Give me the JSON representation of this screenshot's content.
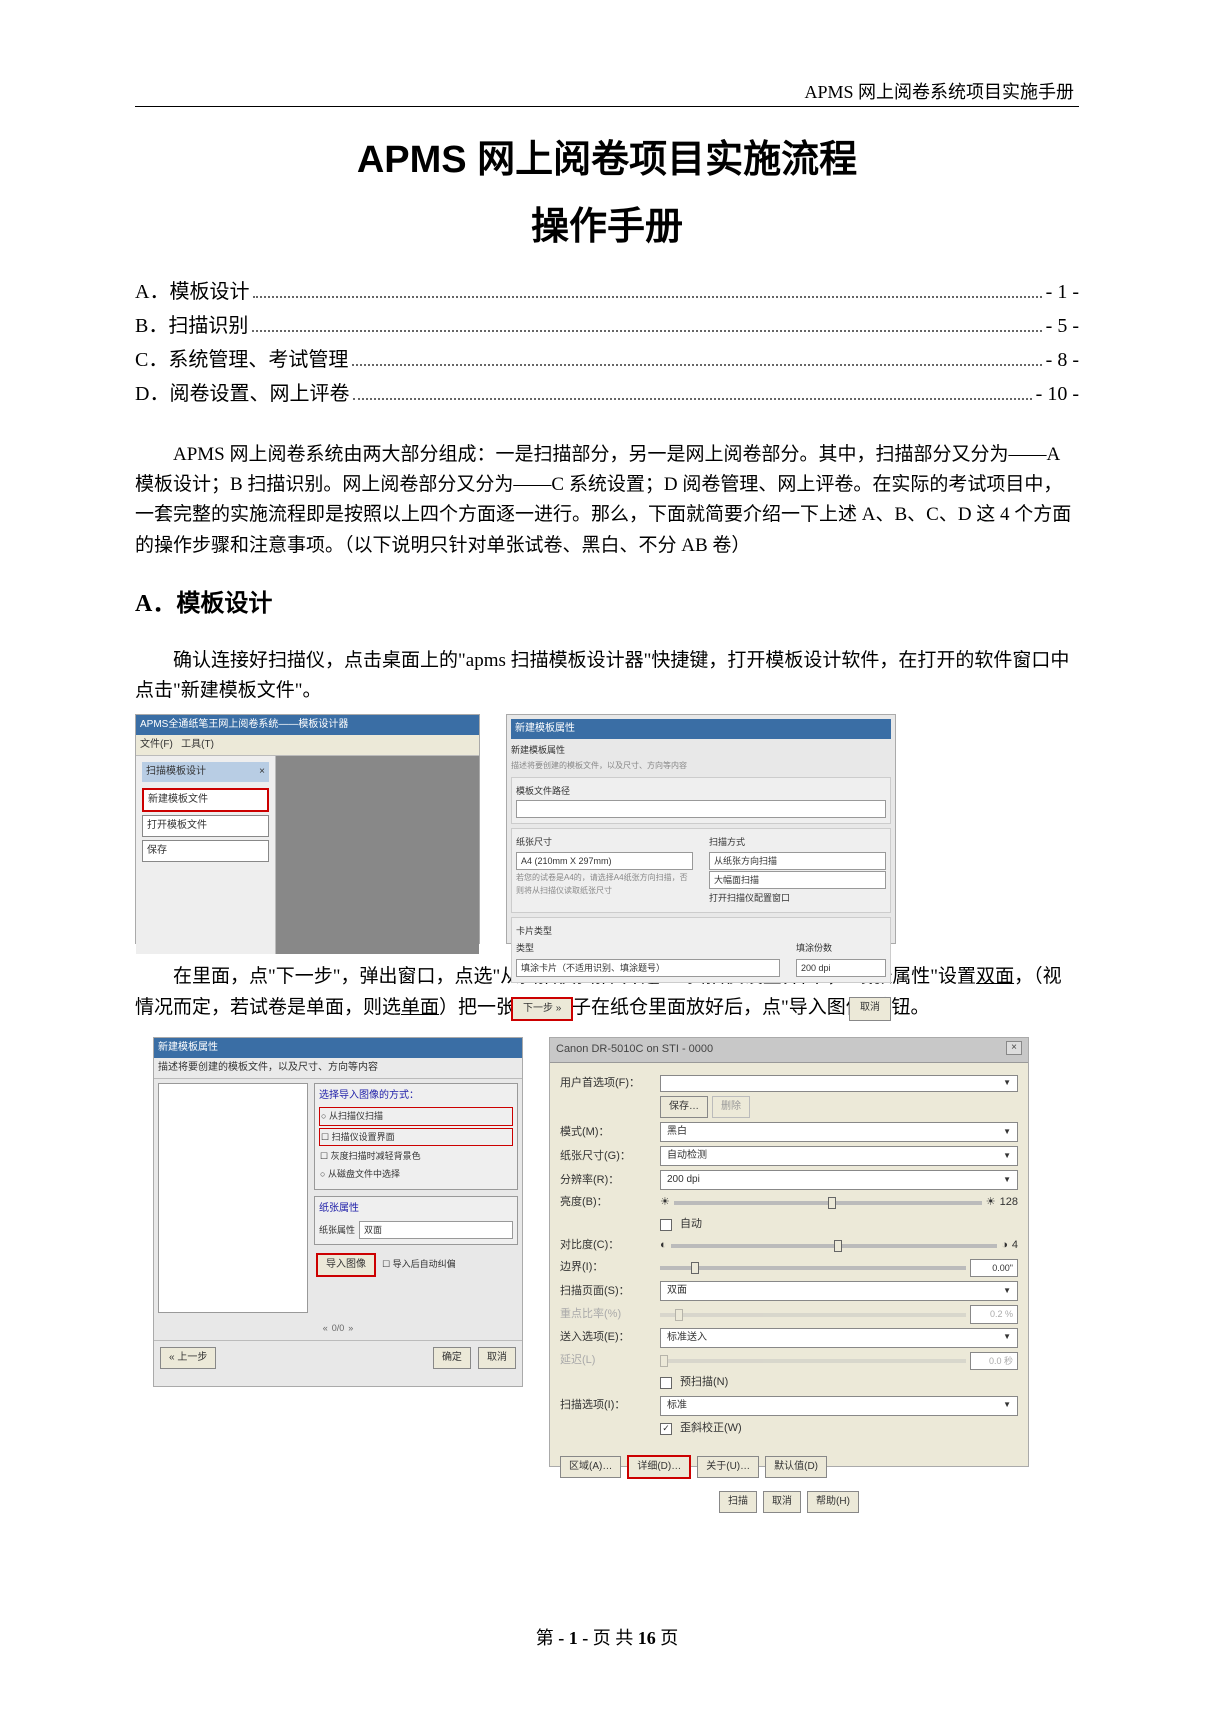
{
  "header": "APMS 网上阅卷系统项目实施手册",
  "title": "APMS 网上阅卷项目实施流程",
  "subtitle": "操作手册",
  "toc": [
    {
      "label": "A．模板设计",
      "page": "- 1 -"
    },
    {
      "label": "B．扫描识别",
      "page": "- 5 -"
    },
    {
      "label": "C．系统管理、考试管理",
      "page": "- 8 -"
    },
    {
      "label": "D．阅卷设置、网上评卷",
      "page": "- 10 -"
    }
  ],
  "intro": "APMS 网上阅卷系统由两大部分组成：一是扫描部分，另一是网上阅卷部分。其中，扫描部分又分为——A 模板设计；B 扫描识别。网上阅卷部分又分为——C 系统设置；D 阅卷管理、网上评卷。在实际的考试项目中，一套完整的实施流程即是按照以上四个方面逐一进行。那么，下面就简要介绍一下上述 A、B、C、D 这 4 个方面的操作步骤和注意事项。（以下说明只针对单张试卷、黑白、不分 AB 卷）",
  "section_a": {
    "heading": "A．模板设计",
    "p1": "确认连接好扫描仪，点击桌面上的\"apms 扫描模板设计器\"快捷键，打开模板设计软件，在打开的软件窗口中点击\"新建模板文件\"。",
    "p2a": "在里面，点\"下一步\"，弹出窗口，点选\"从扫描仪扫描\"并选上\"扫描仪设置界面\"，\"纸张属性\"设置",
    "p2u1": "双面",
    "p2b": "，（视情况而定，若试卷是单面，则选",
    "p2u2": "单面",
    "p2c": "）把一张空白卷子在纸仓里面放好后，点\"导入图像\"按钮。"
  },
  "shot1": {
    "title": "APMS全通纸笔王网上阅卷系统——模板设计器",
    "menu_file": "文件(F)",
    "menu_tool": "工具(T)",
    "panel": "扫描模板设计",
    "close": "×",
    "item1": "新建模板文件",
    "item2": "打开模板文件",
    "item3": "保存"
  },
  "shot2": {
    "title": "新建模板属性",
    "sub": "新建模板属性",
    "tip": "描述将要创建的模板文件，以及尺寸、方向等内容",
    "sect_file": "模板文件路径",
    "g1": "纸张尺寸",
    "g1_opt": "A4 (210mm X 297mm)",
    "g1_lbl2": "扫描方式",
    "g1_opt2": "从纸张方向扫描",
    "g1_opt3": "大幅面扫描",
    "g1_note": "若您的试卷是A4的，请选择A4纸张方向扫描，否则将从扫描仪读取纸张尺寸",
    "g1_chk": "打开扫描仪配置窗口",
    "g2": "卡片类型",
    "g2_lbl": "类型",
    "g2_opt": "填涂卡片（不适用识别、填涂题号）",
    "g2_lbl2": "填涂份数",
    "g2_opt2": "200 dpi",
    "btn_next": "下一步 »",
    "btn_cancel": "取消"
  },
  "shot3": {
    "title": "新建模板属性",
    "sub": "描述将要创建的模板文件，以及尺寸、方向等内容",
    "grp1": "选择导入图像的方式：",
    "r1": "从扫描仪扫描",
    "r2": "扫描仪设置界面",
    "r3": "灰度扫描时减轻背景色",
    "r4": "从磁盘文件中选择",
    "grp2": "纸张属性",
    "lbl_prop": "纸张属性",
    "opt_prop": "双面",
    "btn_import": "导入图像",
    "chk_auto": "导入后自动纠偏",
    "pager": "0/0",
    "btn_prev": "« 上一步",
    "btn_ok": "确定",
    "btn_cancel": "取消"
  },
  "shot4": {
    "title": "Canon DR-5010C on STI - 0000",
    "close": "×",
    "lbl_pref": "用户首选项(F)：",
    "btn_save": "保存…",
    "btn_del": "删除",
    "lbl_mode": "模式(M)：",
    "val_mode": "黑白",
    "lbl_size": "纸张尺寸(G)：",
    "val_size": "自动检测",
    "lbl_dpi": "分辨率(R)：",
    "val_dpi": "200 dpi",
    "lbl_bright": "亮度(B)：",
    "bright_auto": "自动",
    "bright_val": "128",
    "lbl_contrast": "对比度(C)：",
    "contrast_val": "4",
    "lbl_margin": "边界(I)：",
    "margin_val": "0.00\"",
    "lbl_side": "扫描页面(S)：",
    "val_side": "双面",
    "lbl_ratio": "重点比率(%)",
    "ratio_val": "0.2 %",
    "lbl_feed": "送入选项(E)：",
    "val_feed": "标准送入",
    "lbl_delay": "延迟(L)",
    "delay_val": "0.0 秒",
    "chk_prescan": "预扫描(N)",
    "lbl_opt": "扫描选项(I)：",
    "val_opt": "标准",
    "chk_deskew": "歪斜校正(W)",
    "btn_area": "区域(A)…",
    "btn_detail": "详细(D)…",
    "btn_about": "关于(U)…",
    "btn_default": "默认值(D)",
    "btn_scan": "扫描",
    "btn_cancel": "取消",
    "btn_help": "帮助(H)"
  },
  "footer": {
    "p1": "第",
    "cur": "- 1 -",
    "p2": "页     共",
    "total": "16",
    "p3": "页"
  }
}
